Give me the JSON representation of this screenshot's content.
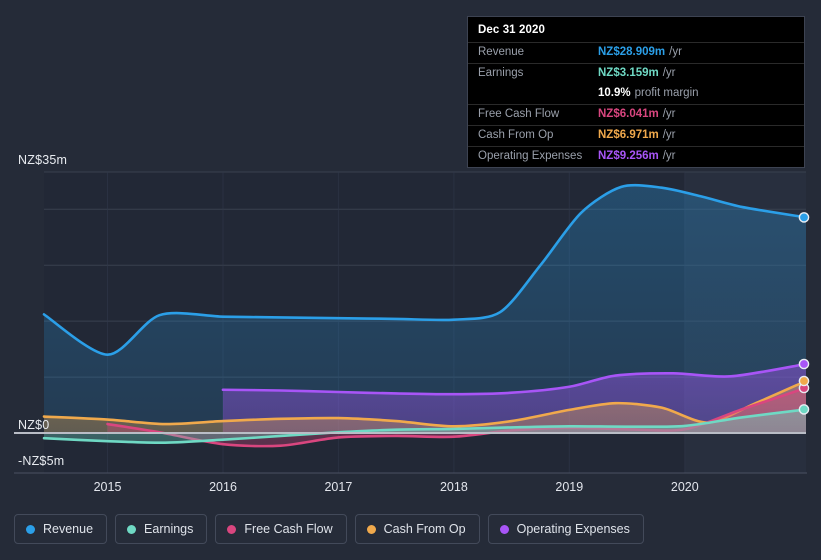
{
  "chart_data": {
    "type": "area",
    "title": "",
    "xlabel": "",
    "ylabel": "",
    "currency": "NZ$",
    "units": "m",
    "ylim": [
      -5,
      35
    ],
    "y_ticks": [
      {
        "label": "NZ$35m",
        "value": 35
      },
      {
        "label": "NZ$0",
        "value": 0
      },
      {
        "label": "-NZ$5m",
        "value": -5
      }
    ],
    "x_ticks": [
      "2015",
      "2016",
      "2017",
      "2018",
      "2019",
      "2020"
    ],
    "x_range": [
      "2014.4",
      "2021.1"
    ],
    "grid": true,
    "legend_position": "bottom",
    "zero_line": true,
    "highlight_from": "2020",
    "series": [
      {
        "name": "Revenue",
        "color": "#2b9fe8",
        "x": [
          2014.45,
          2015.0,
          2015.45,
          2016.0,
          2016.5,
          2017.0,
          2017.5,
          2018.0,
          2018.4,
          2018.75,
          2019.1,
          2019.45,
          2019.8,
          2020.15,
          2020.5,
          2021.05
        ],
        "values": [
          15.9,
          10.5,
          15.8,
          15.6,
          15.5,
          15.4,
          15.3,
          15.2,
          16.2,
          22.5,
          29.5,
          33.0,
          32.9,
          31.7,
          30.3,
          28.909
        ]
      },
      {
        "name": "Earnings",
        "color": "#6fd9c4",
        "x": [
          2014.45,
          2015.0,
          2015.5,
          2016.0,
          2016.5,
          2017.0,
          2017.5,
          2018.0,
          2018.5,
          2019.0,
          2019.5,
          2020.0,
          2020.5,
          2021.05
        ],
        "values": [
          -0.7,
          -1.1,
          -1.3,
          -0.9,
          -0.4,
          0.1,
          0.45,
          0.55,
          0.75,
          0.9,
          0.85,
          0.95,
          2.1,
          3.159
        ]
      },
      {
        "name": "Free Cash Flow",
        "color": "#d9467f",
        "x": [
          2015.0,
          2015.45,
          2016.0,
          2016.5,
          2017.0,
          2017.5,
          2018.0,
          2018.5,
          2019.0,
          2019.5,
          2020.0,
          2020.5,
          2021.05
        ],
        "values": [
          1.2,
          0.1,
          -1.5,
          -1.7,
          -0.6,
          -0.4,
          -0.5,
          0.35,
          0.7,
          0.5,
          0.5,
          3.2,
          6.041
        ]
      },
      {
        "name": "Cash From Op",
        "color": "#f0a94c",
        "x": [
          2014.45,
          2015.0,
          2015.5,
          2016.0,
          2016.5,
          2017.0,
          2017.5,
          2018.0,
          2018.5,
          2019.0,
          2019.4,
          2019.8,
          2020.2,
          2020.6,
          2021.05
        ],
        "values": [
          2.2,
          1.8,
          1.2,
          1.6,
          1.9,
          2.0,
          1.6,
          0.9,
          1.6,
          3.1,
          4.0,
          3.4,
          1.4,
          3.9,
          6.971
        ]
      },
      {
        "name": "Operating Expenses",
        "color": "#a855f7",
        "x": [
          2016.0,
          2016.5,
          2017.0,
          2017.5,
          2018.0,
          2018.5,
          2019.0,
          2019.4,
          2019.9,
          2020.4,
          2021.05
        ],
        "values": [
          5.8,
          5.7,
          5.5,
          5.3,
          5.2,
          5.4,
          6.2,
          7.7,
          8.0,
          7.6,
          9.256
        ]
      }
    ]
  },
  "tooltip": {
    "title": "Dec 31 2020",
    "rows": [
      {
        "key": "Revenue",
        "value": "NZ$28.909m",
        "unit": "/yr",
        "color": "#2b9fe8"
      },
      {
        "key": "Earnings",
        "value": "NZ$3.159m",
        "unit": "/yr",
        "color": "#6fd9c4"
      },
      {
        "key": "",
        "value": "10.9%",
        "unit": "profit margin",
        "color": "#ffffff"
      },
      {
        "key": "Free Cash Flow",
        "value": "NZ$6.041m",
        "unit": "/yr",
        "color": "#d9467f"
      },
      {
        "key": "Cash From Op",
        "value": "NZ$6.971m",
        "unit": "/yr",
        "color": "#f0a94c"
      },
      {
        "key": "Operating Expenses",
        "value": "NZ$9.256m",
        "unit": "/yr",
        "color": "#a855f7"
      }
    ]
  },
  "legend": {
    "items": [
      {
        "label": "Revenue",
        "color": "#2b9fe8"
      },
      {
        "label": "Earnings",
        "color": "#6fd9c4"
      },
      {
        "label": "Free Cash Flow",
        "color": "#d9467f"
      },
      {
        "label": "Cash From Op",
        "color": "#f0a94c"
      },
      {
        "label": "Operating Expenses",
        "color": "#a855f7"
      }
    ]
  },
  "colors": {
    "background": "#252b38",
    "plot_background": "#222836",
    "grid": "#39404f",
    "zero_line": "#b9bdc6",
    "tooltip_background": "#000000"
  }
}
